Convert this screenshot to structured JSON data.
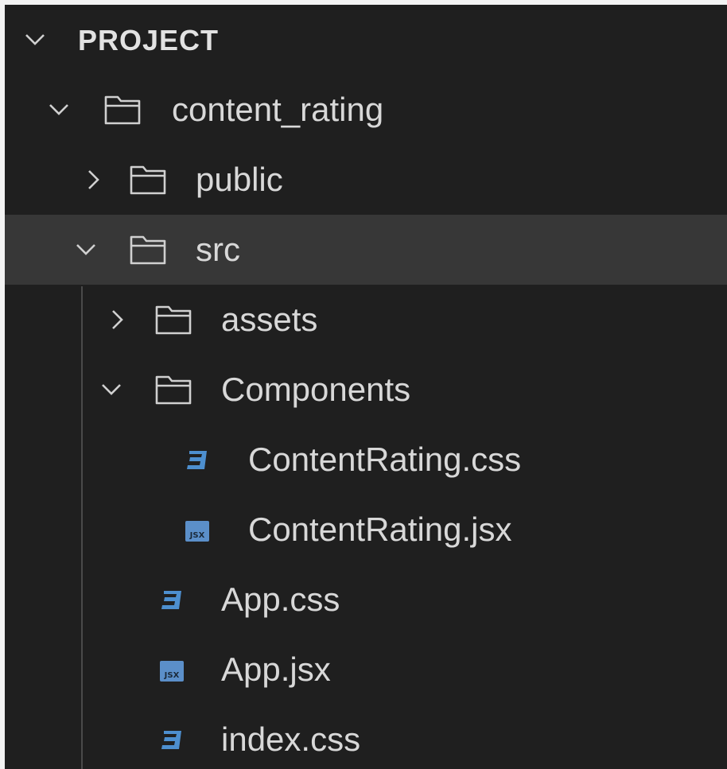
{
  "explorer": {
    "section_title": "PROJECT",
    "tree": [
      {
        "label": "content_rating",
        "kind": "folder",
        "expanded": true,
        "icon": "folder-icon",
        "chevron": "chevron-down-icon"
      },
      {
        "label": "public",
        "kind": "folder",
        "expanded": false,
        "icon": "folder-icon",
        "chevron": "chevron-right-icon"
      },
      {
        "label": "src",
        "kind": "folder",
        "expanded": true,
        "selected": true,
        "icon": "folder-icon",
        "chevron": "chevron-down-icon"
      },
      {
        "label": "assets",
        "kind": "folder",
        "expanded": false,
        "icon": "folder-icon",
        "chevron": "chevron-right-icon"
      },
      {
        "label": "Components",
        "kind": "folder",
        "expanded": true,
        "icon": "folder-icon",
        "chevron": "chevron-down-icon"
      },
      {
        "label": "ContentRating.css",
        "kind": "file",
        "icon": "css-file-icon"
      },
      {
        "label": "ContentRating.jsx",
        "kind": "file",
        "icon": "jsx-file-icon"
      },
      {
        "label": "App.css",
        "kind": "file",
        "icon": "css-file-icon"
      },
      {
        "label": "App.jsx",
        "kind": "file",
        "icon": "jsx-file-icon"
      },
      {
        "label": "index.css",
        "kind": "file",
        "icon": "css-file-icon"
      }
    ],
    "jsx_badge_text": "JSX",
    "colors": {
      "background": "#1f1f1f",
      "selected_row": "#373737",
      "text": "#d8d8d8",
      "css_icon": "#4d8fcf",
      "jsx_icon": "#5b8fc9",
      "indent_guide": "#4a4a4a"
    }
  }
}
